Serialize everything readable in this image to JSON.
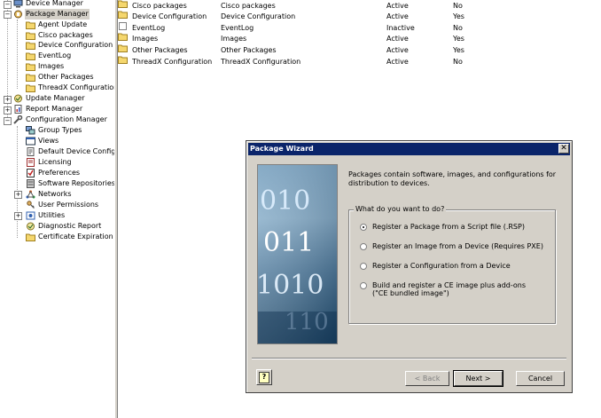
{
  "tree": {
    "items": [
      {
        "label": "Device Manager",
        "icon": "device-manager-icon"
      },
      {
        "label": "Package Manager",
        "icon": "package-manager-icon"
      },
      {
        "label": "Agent Update",
        "icon": "folder-icon"
      },
      {
        "label": "Cisco packages",
        "icon": "folder-icon"
      },
      {
        "label": "Device Configuration",
        "icon": "folder-icon"
      },
      {
        "label": "EventLog",
        "icon": "folder-icon"
      },
      {
        "label": "Images",
        "icon": "folder-icon"
      },
      {
        "label": "Other Packages",
        "icon": "folder-icon"
      },
      {
        "label": "ThreadX Configuration",
        "icon": "folder-icon"
      },
      {
        "label": "Update Manager",
        "icon": "update-manager-icon"
      },
      {
        "label": "Report Manager",
        "icon": "report-manager-icon"
      },
      {
        "label": "Configuration Manager",
        "icon": "configuration-manager-icon"
      },
      {
        "label": "Group Types",
        "icon": "group-types-icon"
      },
      {
        "label": "Views",
        "icon": "views-icon"
      },
      {
        "label": "Default Device Configu",
        "icon": "default-config-icon"
      },
      {
        "label": "Licensing",
        "icon": "licensing-icon"
      },
      {
        "label": "Preferences",
        "icon": "preferences-icon"
      },
      {
        "label": "Software Repositories",
        "icon": "repository-icon"
      },
      {
        "label": "Networks",
        "icon": "networks-icon"
      },
      {
        "label": "User Permissions",
        "icon": "user-permissions-icon"
      },
      {
        "label": "Utilities",
        "icon": "utilities-icon"
      },
      {
        "label": "Diagnostic Report",
        "icon": "diagnostic-icon"
      },
      {
        "label": "Certificate Expiration Ti",
        "icon": "certificate-icon"
      }
    ]
  },
  "list": {
    "rows": [
      {
        "name": "Cisco packages",
        "description": "Cisco packages",
        "status": "Active",
        "default": "No",
        "icon": "folder-icon"
      },
      {
        "name": "Device Configuration",
        "description": "Device Configuration",
        "status": "Active",
        "default": "Yes",
        "icon": "folder-icon"
      },
      {
        "name": "EventLog",
        "description": "EventLog",
        "status": "Inactive",
        "default": "No",
        "icon": "document-icon"
      },
      {
        "name": "Images",
        "description": "Images",
        "status": "Active",
        "default": "Yes",
        "icon": "folder-icon"
      },
      {
        "name": "Other Packages",
        "description": "Other Packages",
        "status": "Active",
        "default": "Yes",
        "icon": "folder-icon"
      },
      {
        "name": "ThreadX Configuration",
        "description": "ThreadX Configuration",
        "status": "Active",
        "default": "No",
        "icon": "folder-icon"
      }
    ]
  },
  "dialog": {
    "title": "Package Wizard",
    "close_glyph": "✕",
    "intro": "Packages contain software, images, and configurations for distribution to devices.",
    "group_label": "What do you want to do?",
    "options": [
      {
        "label": "Register a Package from a Script file (.RSP)",
        "selected": true
      },
      {
        "label": "Register an Image from a Device (Requires PXE)",
        "selected": false
      },
      {
        "label": "Register a Configuration from a Device",
        "selected": false
      },
      {
        "label": "Build and register a CE image plus add-ons",
        "label2": "(\"CE bundled image\")",
        "selected": false
      }
    ],
    "image_digits": [
      "010",
      "011",
      "1010",
      "110"
    ],
    "buttons": {
      "help": "?",
      "back": "< Back",
      "next": "Next >",
      "cancel": "Cancel"
    }
  },
  "colors": {
    "titlebar": "#0a246a",
    "face": "#d4d0c8",
    "folder": "#f5d76e"
  }
}
